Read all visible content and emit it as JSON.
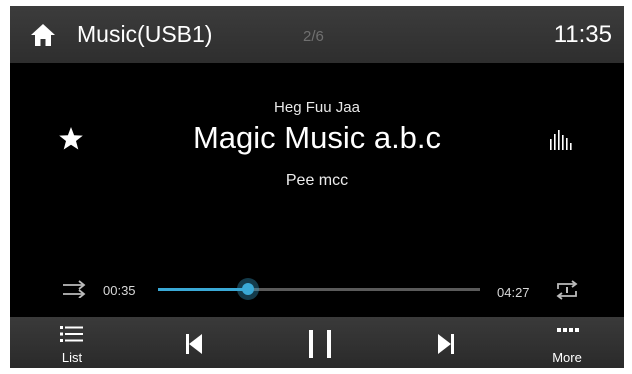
{
  "header": {
    "source_title": "Music(USB1)",
    "track_count": "2/6",
    "clock": "11:35",
    "home_icon": "home-icon"
  },
  "now_playing": {
    "album": "Heg Fuu Jaa",
    "title": "Magic Music a.b.c",
    "artist": "Pee mcc",
    "favorite_icon": "star-icon",
    "eq_icon": "equalizer-icon"
  },
  "progress": {
    "elapsed": "00:35",
    "total": "04:27",
    "fraction": 0.28,
    "shuffle_icon": "shuffle-icon",
    "repeat_icon": "repeat-icon"
  },
  "controls": {
    "list_label": "List",
    "more_label": "More",
    "prev_icon": "skip-previous-icon",
    "pause_icon": "pause-icon",
    "next_icon": "skip-next-icon"
  },
  "colors": {
    "accent": "#3aa9d6",
    "background": "#000000",
    "bar": "#333333"
  }
}
